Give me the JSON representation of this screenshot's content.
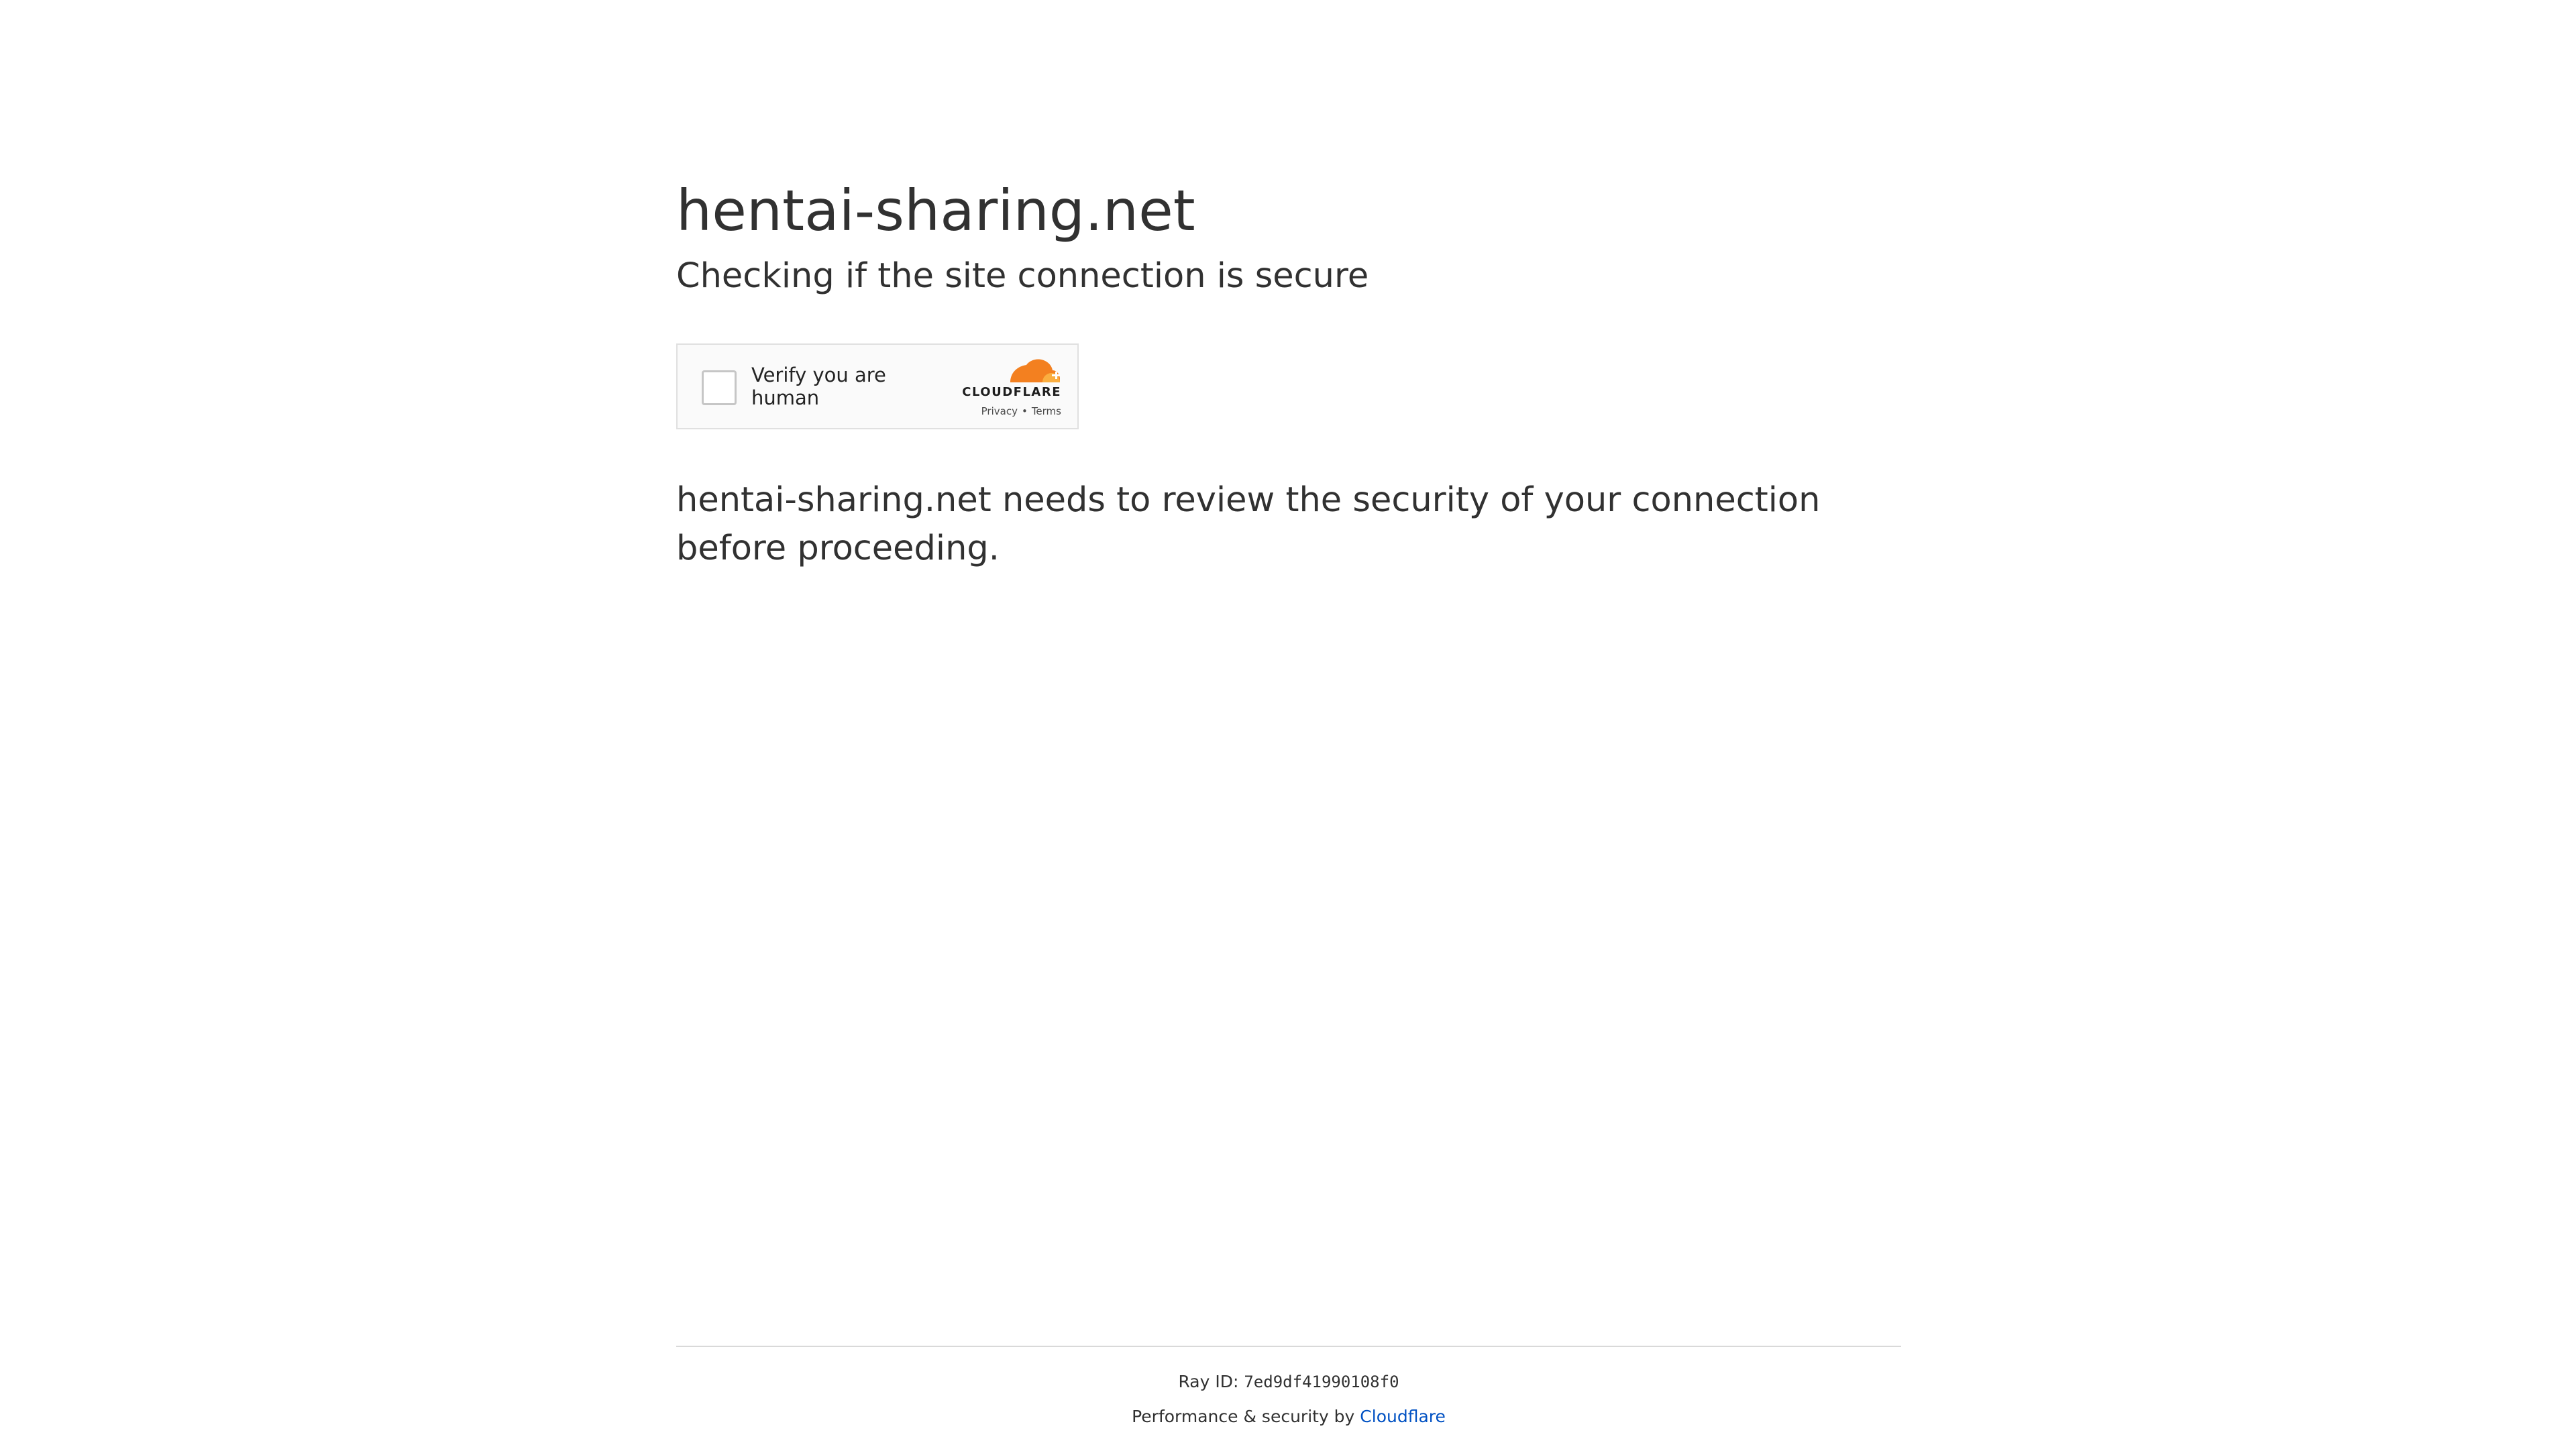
{
  "page": {
    "site_title": "hentai-sharing.net",
    "subtitle": "Checking if the site connection is secure",
    "description": "hentai-sharing.net needs to review the security of your connection before proceeding."
  },
  "widget": {
    "verify_label": "Verify you are human",
    "brand": "CLOUDFLARE",
    "privacy_link": "Privacy",
    "separator": "•",
    "terms_link": "Terms",
    "cloud_icon": "cloudflare-cloud-icon",
    "brand_colors": {
      "orange": "#f38020",
      "light_orange": "#faae40"
    }
  },
  "footer": {
    "ray_label": "Ray ID: ",
    "ray_id": "7ed9df41990108f0",
    "perf_text": "Performance & security by ",
    "cloudflare_link": "Cloudflare",
    "link_color": "#0051c3"
  }
}
